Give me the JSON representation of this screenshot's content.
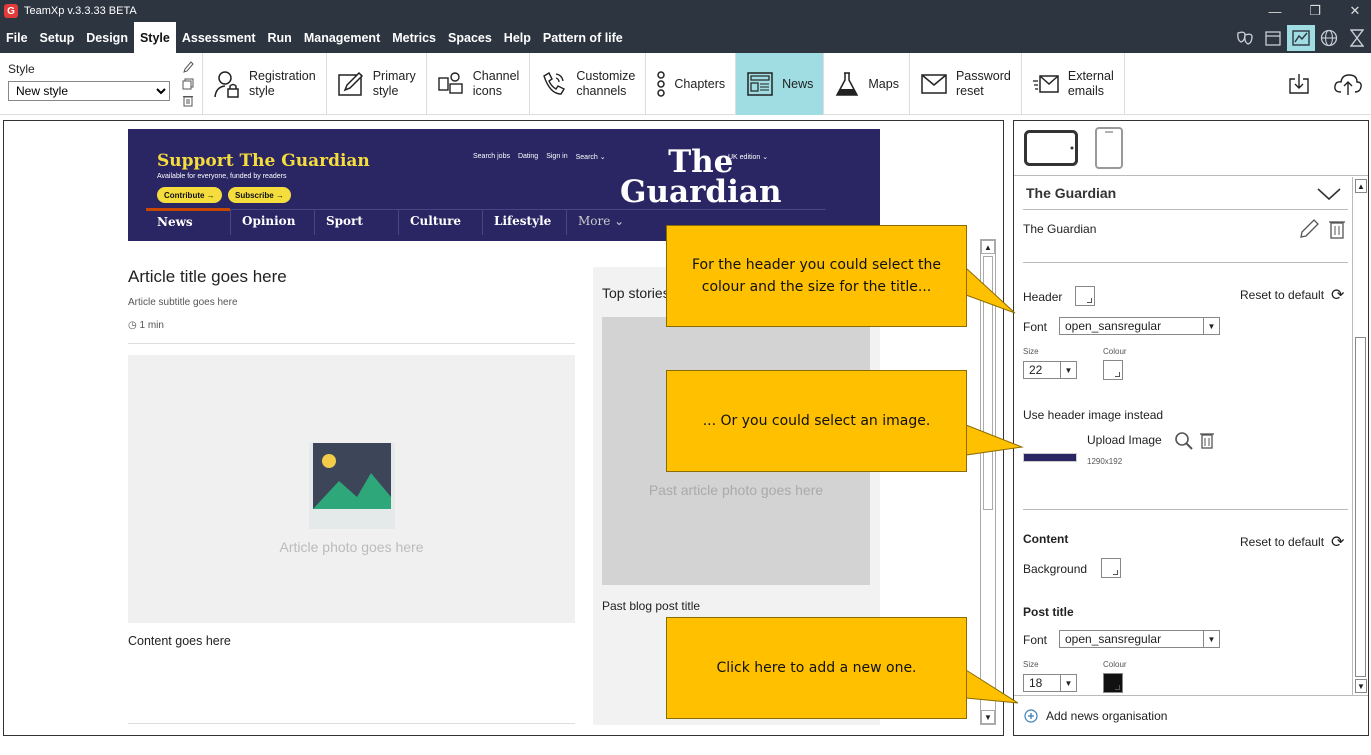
{
  "window": {
    "title": "TeamXp v.3.3.33 BETA",
    "logo": "G"
  },
  "menu": [
    "File",
    "Setup",
    "Design",
    "Style",
    "Assessment",
    "Run",
    "Management",
    "Metrics",
    "Spaces",
    "Help",
    "Pattern of life"
  ],
  "menu_active": "Style",
  "toolbar": {
    "style_label": "Style",
    "style_value": "New style",
    "buttons": {
      "registration": "Registration\nstyle",
      "primary": "Primary\nstyle",
      "channel_icons": "Channel\nicons",
      "customize": "Customize\nchannels",
      "chapters": "Chapters",
      "news": "News",
      "maps": "Maps",
      "password": "Password\nreset",
      "external": "External\nemails"
    },
    "active": "News"
  },
  "preview": {
    "guardian": {
      "support": "Support The Guardian",
      "avail": "Available for everyone, funded by readers",
      "contribute": "Contribute →",
      "subscribe": "Subscribe →",
      "links": [
        "Search jobs",
        "Dating",
        "Sign in",
        "Search ⌄"
      ],
      "edition": "UK edition ⌄",
      "logo_line1": "The",
      "logo_line2": "Guardian",
      "nav": [
        "News",
        "Opinion",
        "Sport",
        "Culture",
        "Lifestyle",
        "More ⌄"
      ]
    },
    "article": {
      "title": "Article title goes here",
      "subtitle": "Article subtitle goes here",
      "time": "1 min",
      "photo_caption": "Article photo goes here",
      "content": "Content goes here"
    },
    "top_stories": {
      "title": "Top stories",
      "photo_caption": "Past article photo goes here",
      "post_title": "Past blog post title"
    }
  },
  "panel": {
    "org_name": "The Guardian",
    "org_value": "The Guardian",
    "header": {
      "label": "Header",
      "reset": "Reset to default",
      "font_label": "Font",
      "font_value": "open_sansregular",
      "size_label": "Size",
      "colour_label": "Colour",
      "size_value": "22",
      "image_label": "Use header image instead",
      "upload": "Upload Image",
      "dims": "1290x192"
    },
    "content": {
      "label": "Content",
      "reset": "Reset to default",
      "background": "Background"
    },
    "post_title": {
      "label": "Post title",
      "font_label": "Font",
      "font_value": "open_sansregular",
      "size_label": "Size",
      "colour_label": "Colour",
      "size_value": "18"
    },
    "add": "Add news organisation"
  },
  "callouts": {
    "one": "For the header you could select the colour and the size for the title...",
    "two": "... Or you could select an image.",
    "three": "Click here to add a new one."
  },
  "colors": {
    "accent": "#9fdde2",
    "callout": "#ffc000",
    "chrome": "#2d3541",
    "guardian_bg": "#2a2563",
    "guardian_yellow": "#f5dd3e"
  }
}
